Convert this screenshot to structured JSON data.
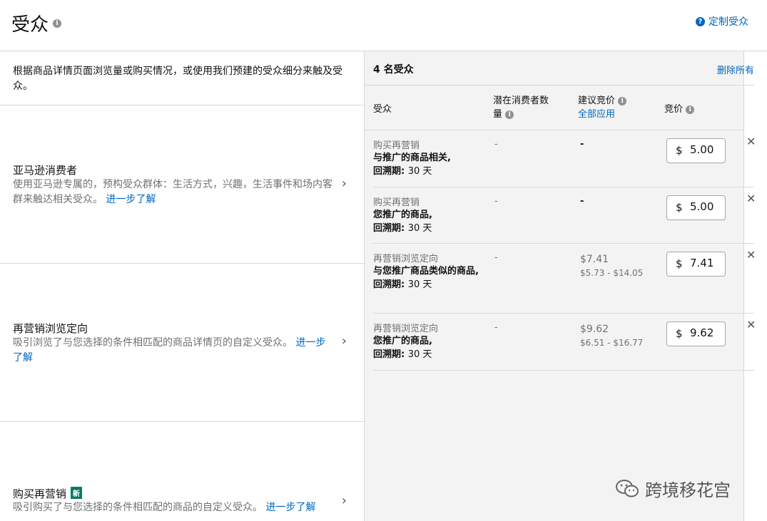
{
  "header": {
    "title": "受众",
    "customize_label": "定制受众"
  },
  "left": {
    "intro": "根据商品详情页面浏览量或购买情况，或使用我们预建的受众细分来触及受众。",
    "options": [
      {
        "title": "亚马逊消费者",
        "desc": "使用亚马逊专属的，预构受众群体：生活方式，兴趣，生活事件和场内客群来触达相关受众。",
        "link": "进一步了解"
      },
      {
        "title": "再营销浏览定向",
        "desc": "吸引浏览了与您选择的条件相匹配的商品详情页的自定义受众。",
        "link": "进一步了解"
      },
      {
        "title": "购买再营销",
        "badge": "新",
        "desc": "吸引购买了与您选择的条件相匹配的商品的自定义受众。",
        "link": "进一步了解"
      }
    ]
  },
  "right": {
    "count": "4 名受众",
    "delete_all": "删除所有",
    "columns": {
      "audience": "受众",
      "reach": "潜在消费者数量",
      "suggested": "建议竞价",
      "apply_all": "全部应用",
      "bid": "竞价"
    },
    "rows": [
      {
        "type": "购买再营销",
        "detail1": "与推广的商品相关,",
        "lookback_label": "回溯期:",
        "lookback_value": "30 天",
        "reach": "-",
        "suggested": "-",
        "range": "",
        "currency": "$",
        "bid": "5.00"
      },
      {
        "type": "购买再营销",
        "detail1": "您推广的商品,",
        "lookback_label": "回溯期:",
        "lookback_value": "30 天",
        "reach": "-",
        "suggested": "-",
        "range": "",
        "currency": "$",
        "bid": "5.00"
      },
      {
        "type": "再营销浏览定向",
        "detail1": "与您推广商品类似的商品,",
        "lookback_label": "回溯期:",
        "lookback_value": "30 天",
        "reach": "-",
        "suggested": "$7.41",
        "range": "$5.73 - $14.05",
        "currency": "$",
        "bid": "7.41"
      },
      {
        "type": "再营销浏览定向",
        "detail1": "您推广的商品,",
        "lookback_label": "回溯期:",
        "lookback_value": "30 天",
        "reach": "-",
        "suggested": "$9.62",
        "range": "$6.51 - $16.77",
        "currency": "$",
        "bid": "9.62"
      }
    ]
  },
  "watermark": "跨境移花宫"
}
